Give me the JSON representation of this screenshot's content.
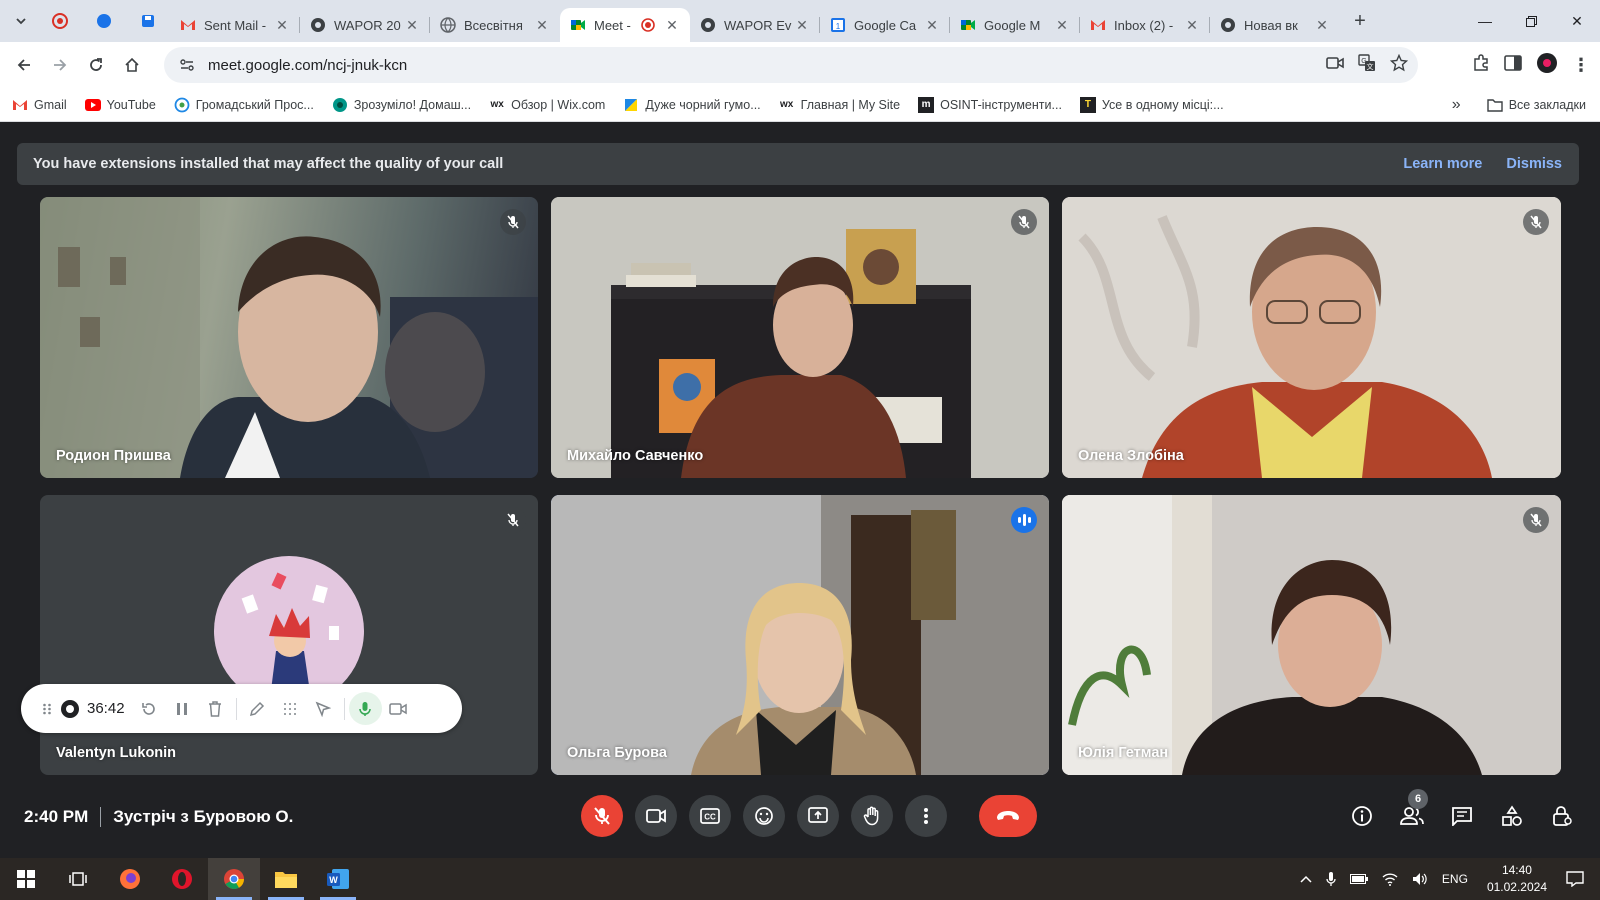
{
  "browser": {
    "tabs": [
      {
        "title": "Sent Mail -",
        "icon": "gmail-icon"
      },
      {
        "title": "WAPOR 20",
        "icon": "globe-icon"
      },
      {
        "title": "Всесвітня",
        "icon": "globe-icon"
      },
      {
        "title": "Meet -",
        "icon": "meet-icon",
        "active": true,
        "recording": true
      },
      {
        "title": "WAPOR Ev",
        "icon": "globe-icon"
      },
      {
        "title": "Google Ca",
        "icon": "calendar-icon"
      },
      {
        "title": "Google M",
        "icon": "meet-icon"
      },
      {
        "title": "Inbox (2) -",
        "icon": "gmail-icon"
      },
      {
        "title": "Новая вк",
        "icon": "chrome-icon"
      }
    ],
    "url": "meet.google.com/ncj-jnuk-kcn",
    "bookmarks": [
      {
        "label": "Gmail",
        "icon": "gmail-icon"
      },
      {
        "label": "YouTube",
        "icon": "youtube-icon"
      },
      {
        "label": "Громадський Прос...",
        "icon": "globe-icon"
      },
      {
        "label": "Зрозуміло! Домаш...",
        "icon": "site-icon"
      },
      {
        "label": "Обзор | Wix.com",
        "icon": "wix-icon"
      },
      {
        "label": "Дуже чорний гумо...",
        "icon": "flag-icon"
      },
      {
        "label": "Главная | My Site",
        "icon": "wix-icon"
      },
      {
        "label": "OSINT-інструменти...",
        "icon": "m-icon"
      },
      {
        "label": "Усе в одному місці:...",
        "icon": "t-icon"
      }
    ],
    "all_bookmarks": "Все закладки"
  },
  "banner": {
    "message": "You have extensions installed that may affect the quality of your call",
    "learn_more": "Learn more",
    "dismiss": "Dismiss"
  },
  "participants": [
    {
      "name": "Родион Пришва",
      "muted": true
    },
    {
      "name": "Михайло Савченко",
      "muted": true
    },
    {
      "name": "Олена Злобіна",
      "muted": true
    },
    {
      "name": "Valentyn Lukonin",
      "muted": true
    },
    {
      "name": "Ольга Бурова",
      "muted": false,
      "speaking": true
    },
    {
      "name": "Юлія Гетман",
      "muted": true
    }
  ],
  "recorder": {
    "elapsed": "36:42"
  },
  "meeting": {
    "time": "2:40 PM",
    "title": "Зустріч з Буровою О.",
    "people_count": "6"
  },
  "taskbar": {
    "lang": "ENG",
    "time": "14:40",
    "date": "01.02.2024"
  },
  "colors": {
    "accent": "#8ab4f8",
    "end_call": "#ea4335",
    "meet_bg": "#202124",
    "speaking": "#1a73e8"
  }
}
